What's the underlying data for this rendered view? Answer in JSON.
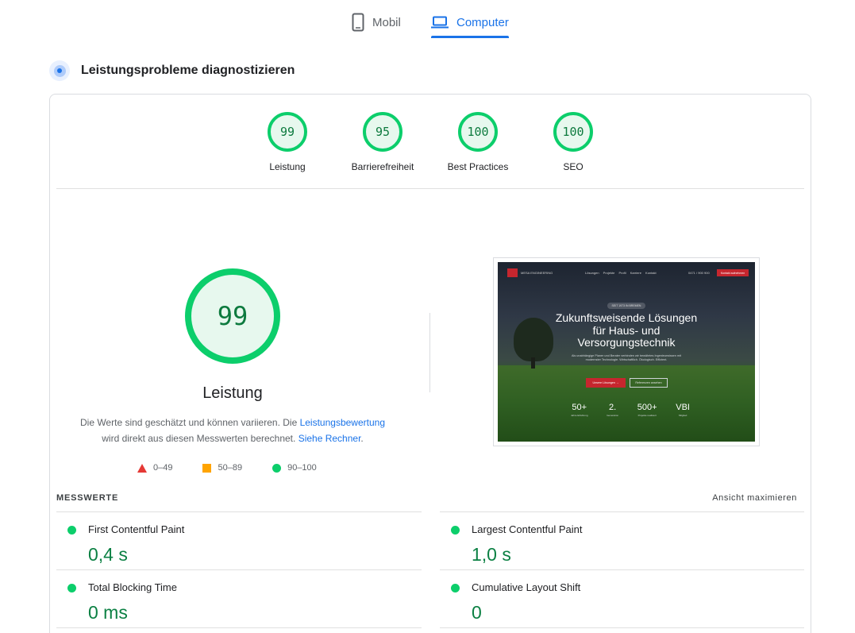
{
  "tabs": {
    "mobile": "Mobil",
    "desktop": "Computer"
  },
  "diagnose": {
    "title": "Leistungsprobleme diagnostizieren"
  },
  "gauges": [
    {
      "score": "99",
      "label": "Leistung"
    },
    {
      "score": "95",
      "label": "Barrierefreiheit"
    },
    {
      "score": "100",
      "label": "Best Practices"
    },
    {
      "score": "100",
      "label": "SEO"
    }
  ],
  "main_score": {
    "score": "99",
    "label": "Leistung",
    "desc_part1": "Die Werte sind geschätzt und können variieren. Die ",
    "desc_link1": "Leistungsbewertung",
    "desc_part2": " wird direkt aus diesen Messwerten berechnet. ",
    "desc_link2": "Siehe Rechner",
    "desc_part3": "."
  },
  "legend": [
    {
      "range": "0–49",
      "color": "#e53935"
    },
    {
      "range": "50–89",
      "color": "#ffa400"
    },
    {
      "range": "90–100",
      "color": "#0cce6b"
    }
  ],
  "screenshot": {
    "logo_text": "MESA ENGINEERING",
    "nav_links": "Lösungen Projekte Profil Karriere Kontakt",
    "nav_phone": "0471 / 900 900",
    "nav_cta": "Kontakt aufnehmen",
    "pill": "SEIT 1973 IN BREMEN",
    "hero_line1": "Zukunftsweisende Lösungen",
    "hero_line2": "für Haus- und",
    "hero_line3": "Versorgungstechnik",
    "subtext": "Als unabhängige Planer und Berater verbinden wir bewährtes Ingenieurwissen mit modernster Technologie. Wirtschaftlich. Ökologisch. Effizient.",
    "btn_primary": "Unsere Lösungen →",
    "btn_secondary": "Referenzen ansehen",
    "stats": [
      {
        "value": "50+",
        "label": "Jahre Erfahrung"
      },
      {
        "value": "2.",
        "label": "Generation"
      },
      {
        "value": "500+",
        "label": "Projekte realisiert"
      },
      {
        "value": "VBI",
        "label": "Mitglied"
      }
    ]
  },
  "metrics": {
    "title": "MESSWERTE",
    "toggle": "Ansicht maximieren",
    "items": [
      {
        "name": "First Contentful Paint",
        "value": "0,4 s"
      },
      {
        "name": "Largest Contentful Paint",
        "value": "1,0 s"
      },
      {
        "name": "Total Blocking Time",
        "value": "0 ms"
      },
      {
        "name": "Cumulative Layout Shift",
        "value": "0"
      }
    ]
  },
  "colors": {
    "accent": "#1a73e8",
    "pass": "#0cce6b",
    "pass_text": "#0b8043"
  }
}
